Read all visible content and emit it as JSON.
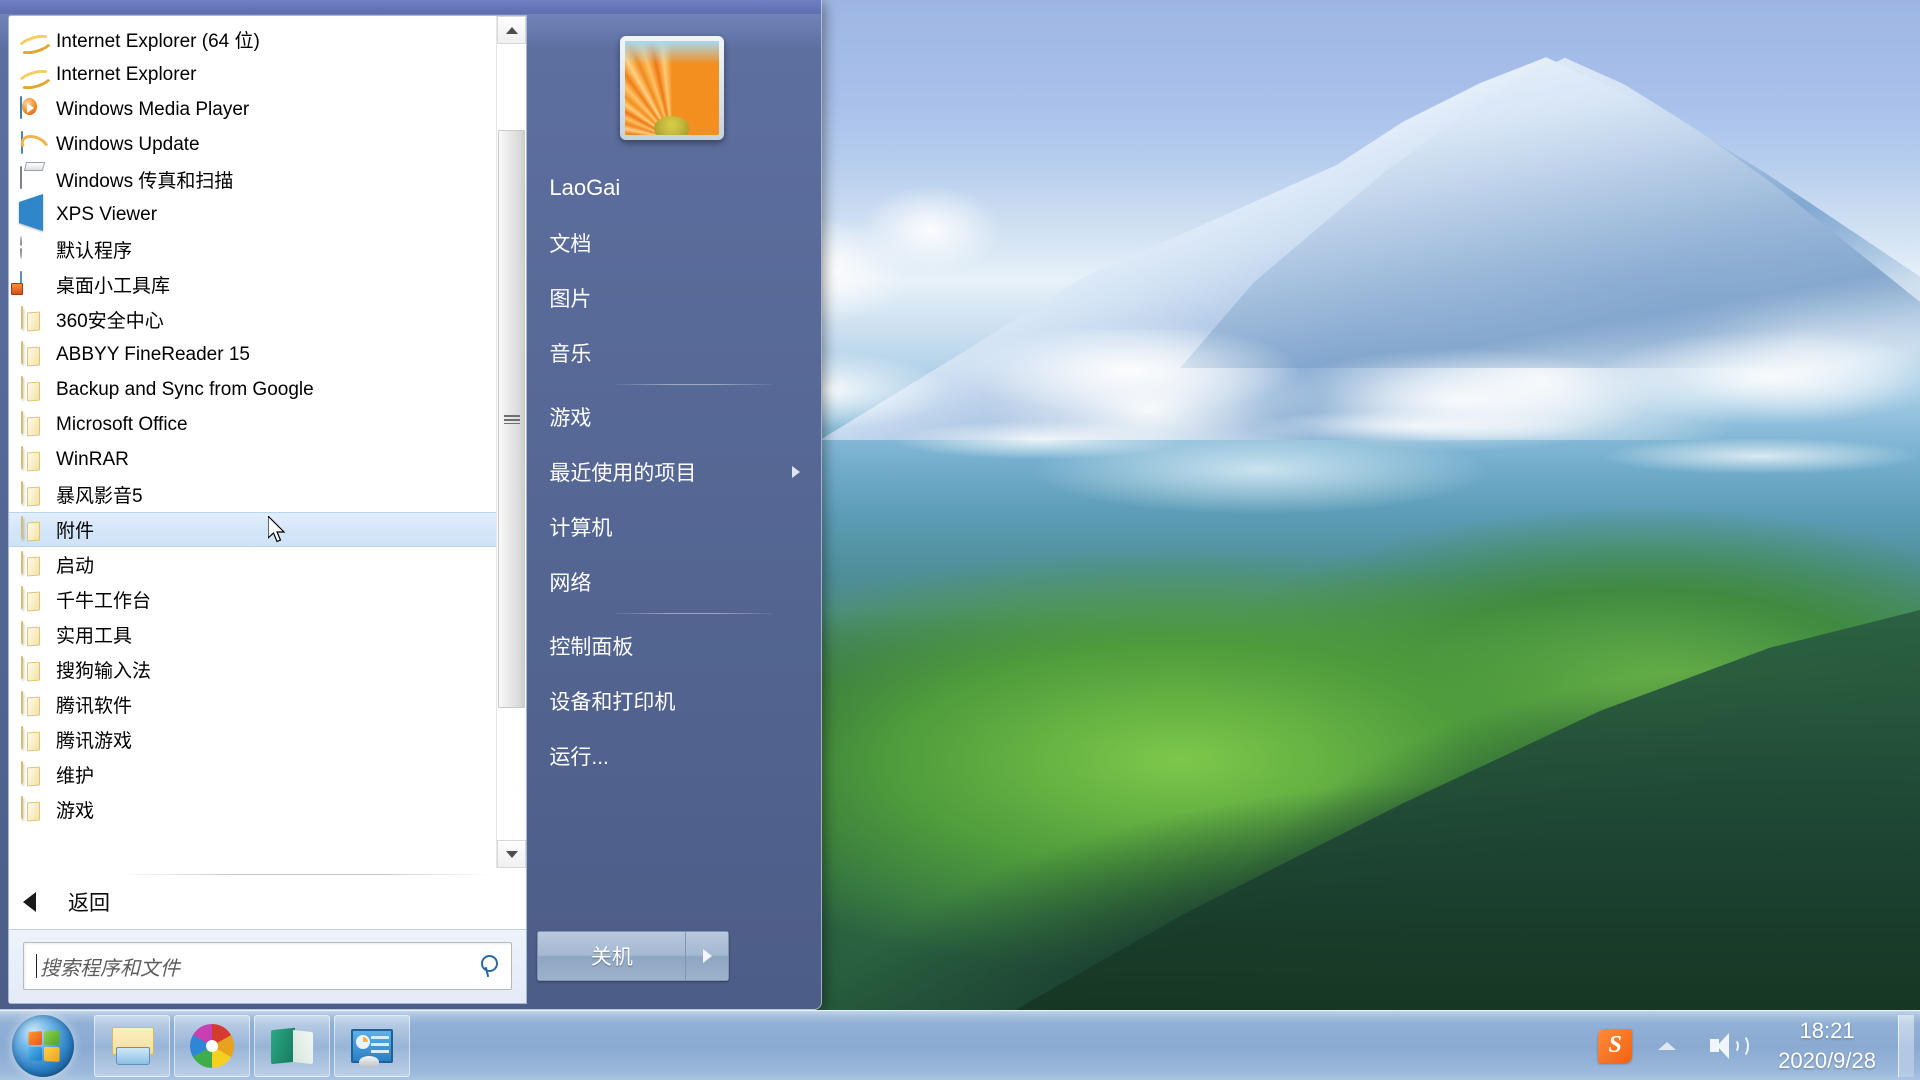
{
  "desktop": {
    "wallpaper_name": "alpine-mountain-wallpaper"
  },
  "start_menu": {
    "programs": [
      {
        "label": "Internet Explorer (64 位)",
        "icon": "internet-explorer-icon",
        "type": "app"
      },
      {
        "label": "Internet Explorer",
        "icon": "internet-explorer-icon",
        "type": "app"
      },
      {
        "label": "Windows Media Player",
        "icon": "windows-media-player-icon",
        "type": "app"
      },
      {
        "label": "Windows Update",
        "icon": "windows-update-icon",
        "type": "app"
      },
      {
        "label": "Windows 传真和扫描",
        "icon": "fax-and-scan-icon",
        "type": "app"
      },
      {
        "label": "XPS Viewer",
        "icon": "xps-viewer-icon",
        "type": "app"
      },
      {
        "label": "默认程序",
        "icon": "default-programs-icon",
        "type": "app"
      },
      {
        "label": "桌面小工具库",
        "icon": "desktop-gadget-gallery-icon",
        "type": "app"
      },
      {
        "label": "360安全中心",
        "icon": "folder-icon",
        "type": "folder"
      },
      {
        "label": "ABBYY FineReader 15",
        "icon": "folder-icon",
        "type": "folder"
      },
      {
        "label": "Backup and Sync from Google",
        "icon": "folder-icon",
        "type": "folder"
      },
      {
        "label": "Microsoft Office",
        "icon": "folder-icon",
        "type": "folder"
      },
      {
        "label": "WinRAR",
        "icon": "folder-icon",
        "type": "folder"
      },
      {
        "label": "暴风影音5",
        "icon": "folder-icon",
        "type": "folder"
      },
      {
        "label": "附件",
        "icon": "folder-icon",
        "type": "folder",
        "selected": true
      },
      {
        "label": "启动",
        "icon": "folder-icon",
        "type": "folder"
      },
      {
        "label": "千牛工作台",
        "icon": "folder-icon",
        "type": "folder"
      },
      {
        "label": "实用工具",
        "icon": "folder-icon",
        "type": "folder"
      },
      {
        "label": "搜狗输入法",
        "icon": "folder-icon",
        "type": "folder"
      },
      {
        "label": "腾讯软件",
        "icon": "folder-icon",
        "type": "folder"
      },
      {
        "label": "腾讯游戏",
        "icon": "folder-icon",
        "type": "folder"
      },
      {
        "label": "维护",
        "icon": "folder-icon",
        "type": "folder"
      },
      {
        "label": "游戏",
        "icon": "folder-icon",
        "type": "folder"
      }
    ],
    "back_label": "返回",
    "search": {
      "placeholder": "搜索程序和文件",
      "value": ""
    },
    "user": {
      "name": "LaoGai",
      "avatar": "flower-avatar"
    },
    "right_items": [
      {
        "label": "文档",
        "has_submenu": false
      },
      {
        "label": "图片",
        "has_submenu": false
      },
      {
        "label": "音乐",
        "has_submenu": false
      },
      {
        "separator_after": true
      },
      {
        "label": "游戏",
        "has_submenu": false
      },
      {
        "label": "最近使用的项目",
        "has_submenu": true
      },
      {
        "label": "计算机",
        "has_submenu": false
      },
      {
        "label": "网络",
        "has_submenu": false
      },
      {
        "separator_after": true
      },
      {
        "label": "控制面板",
        "has_submenu": false
      },
      {
        "label": "设备和打印机",
        "has_submenu": false
      },
      {
        "label": "运行...",
        "has_submenu": false
      }
    ],
    "shutdown_label": "关机"
  },
  "taskbar": {
    "start_orb": "windows-start-orb",
    "buttons": [
      {
        "name": "file-explorer",
        "icon": "folder-explorer-icon"
      },
      {
        "name": "360-browser",
        "icon": "pinwheel-icon"
      },
      {
        "name": "dictionary",
        "icon": "green-book-icon"
      },
      {
        "name": "control-panel-app",
        "icon": "blue-panel-icon"
      }
    ],
    "tray": {
      "ime": "sogou-ime-icon",
      "show_hidden": "chevron-up-icon",
      "volume": "volume-icon",
      "time": "18:21",
      "date": "2020/9/28"
    }
  },
  "colors": {
    "selection": "#cfe3f8",
    "menu_bg": "#5d6f9f",
    "taskbar": "#8aaad2",
    "accent": "#2a69a8"
  }
}
